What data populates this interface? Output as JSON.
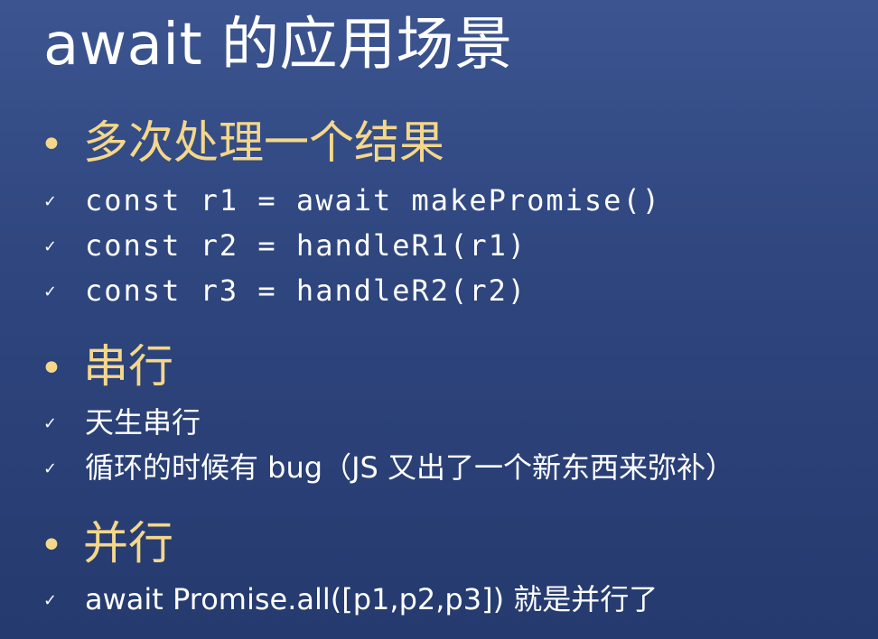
{
  "slide": {
    "title": "await 的应用场景",
    "bullet_glyph": "•",
    "check_glyph": "✓",
    "sections": [
      {
        "heading": "多次处理一个结果",
        "items": [
          "const r1 = await makePromise()",
          "const r2 = handleR1(r1)",
          "const r3 = handleR2(r2)"
        ]
      },
      {
        "heading": "串行",
        "items": [
          "天生串行",
          "循环的时候有 bug（JS 又出了一个新东西来弥补）"
        ]
      },
      {
        "heading": "并行",
        "items": [
          "await Promise.all([p1,p2,p3]) 就是并行了"
        ]
      }
    ]
  },
  "colors": {
    "background_top": "#3c5590",
    "background_bottom": "#253a6e",
    "heading": "#f5d78a",
    "text": "#ffffff"
  }
}
